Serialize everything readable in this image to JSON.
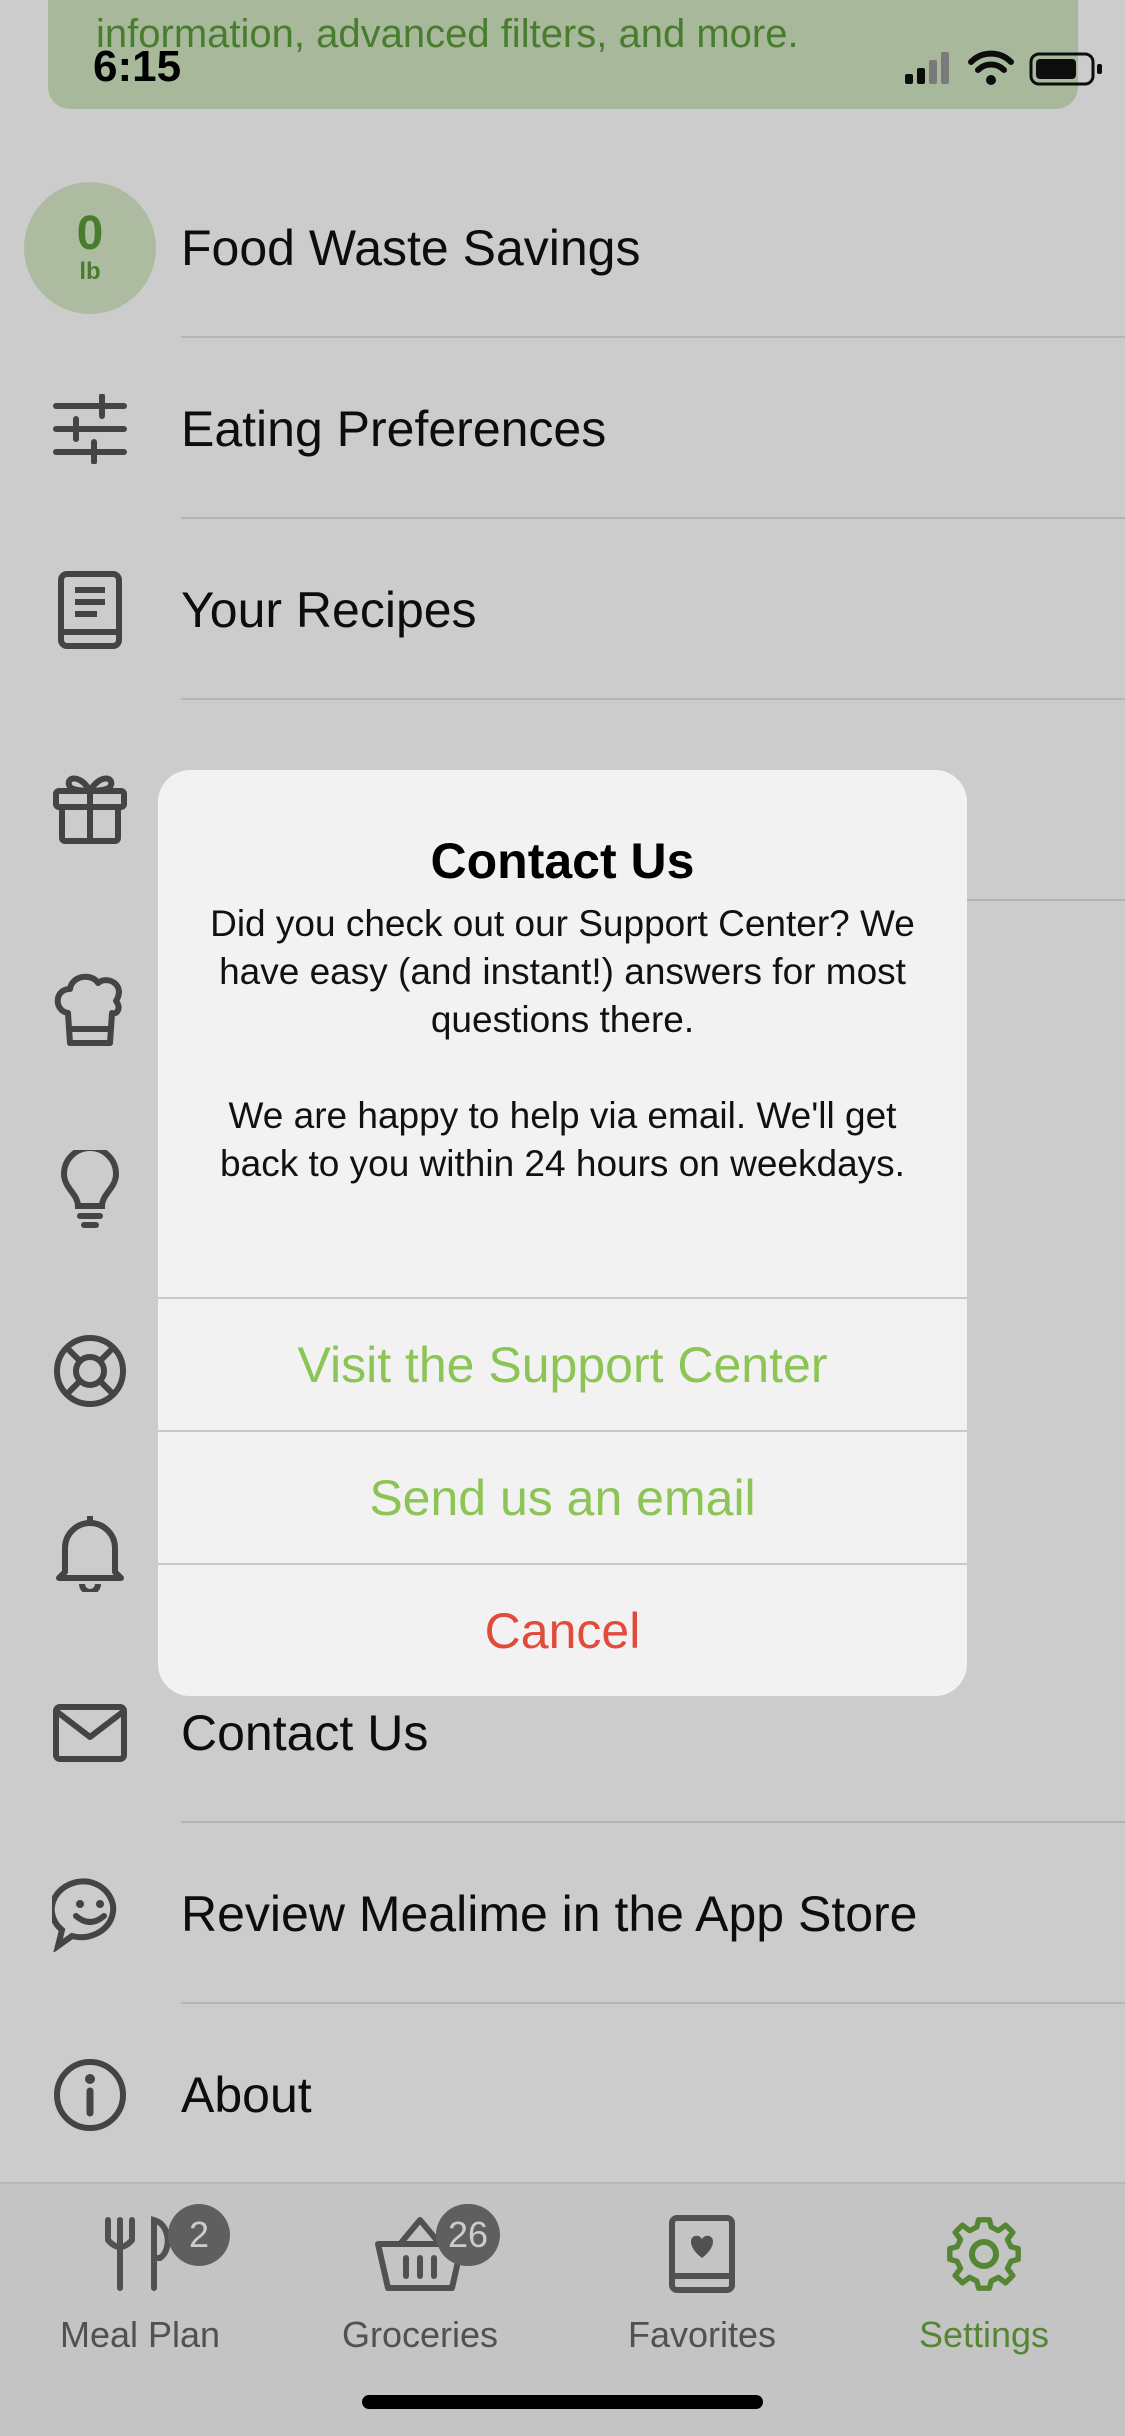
{
  "status_bar": {
    "time": "6:15"
  },
  "promo": {
    "text": "information, advanced filters, and more."
  },
  "waste": {
    "amount": "0",
    "unit": "lb"
  },
  "menu": {
    "food_waste": "Food Waste Savings",
    "eating_preferences": "Eating Preferences",
    "your_recipes": "Your Recipes",
    "contact_us": "Contact Us",
    "review": "Review Mealime in the App Store",
    "about": "About"
  },
  "alert": {
    "title": "Contact Us",
    "message_1": "Did you check out our Support Center? We have easy (and instant!) answers for most questions there.",
    "message_2": "We are happy to help via email. We'll get back to you within 24 hours on weekdays.",
    "visit_support": "Visit the Support Center",
    "send_email": "Send us an email",
    "cancel": "Cancel"
  },
  "tabs": {
    "meal_plan": {
      "label": "Meal Plan",
      "badge": "2"
    },
    "groceries": {
      "label": "Groceries",
      "badge": "26"
    },
    "favorites": {
      "label": "Favorites"
    },
    "settings": {
      "label": "Settings"
    }
  },
  "colors": {
    "accent_green": "#6aa840",
    "alert_button_green": "#8cc455",
    "cancel_red": "#e14b3c",
    "icon_gray": "#555555"
  }
}
